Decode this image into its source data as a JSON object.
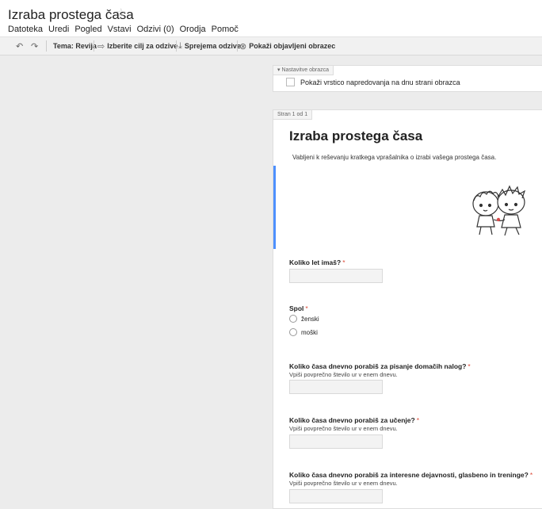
{
  "header": {
    "title": "Izraba prostega časa",
    "menu": [
      "Datoteka",
      "Uredi",
      "Pogled",
      "Vstavi",
      "Odzivi (0)",
      "Orodja",
      "Pomoč"
    ]
  },
  "toolbar": {
    "theme": "Tema: Revija",
    "destination": "Izberite cilj za odzive",
    "accepting": "Sprejema odzive",
    "view_live": "Pokaži objavljeni obrazec"
  },
  "settings": {
    "tab_label": "Nastavitve obrazca",
    "progress_label": "Pokaži vrstico napredovanja na dnu strani obrazca"
  },
  "form": {
    "page_indicator": "Stran 1 od 1",
    "title": "Izraba prostega časa",
    "description": "Vabljeni k reševanju kratkega vprašalnika o izrabi vašega prostega časa.",
    "required_mark": "*",
    "questions": [
      {
        "label": "Koliko let imaš?",
        "help": ""
      },
      {
        "label": "Spol",
        "options": [
          "ženski",
          "moški"
        ]
      },
      {
        "label": "Koliko časa dnevno porabiš za pisanje domačih nalog?",
        "help": "Vpiši povprečno število ur v enem dnevu."
      },
      {
        "label": "Koliko časa dnevno porabiš za učenje?",
        "help": "Vpiši povprečno število ur v enem dnevu."
      },
      {
        "label": "Koliko časa dnevno porabiš za interesne dejavnosti, glasbeno in treninge?",
        "help": "Vpiši povprečno število ur v enem dnevu."
      }
    ]
  },
  "icons": [
    "undo-icon",
    "redo-icon",
    "theme-icon",
    "destination-icon",
    "accepting-responses-icon",
    "view-live-form-icon",
    "star-icon"
  ],
  "colors": {
    "required": "#dd4b39",
    "focus": "#4d90fe",
    "background": "#ececec"
  }
}
